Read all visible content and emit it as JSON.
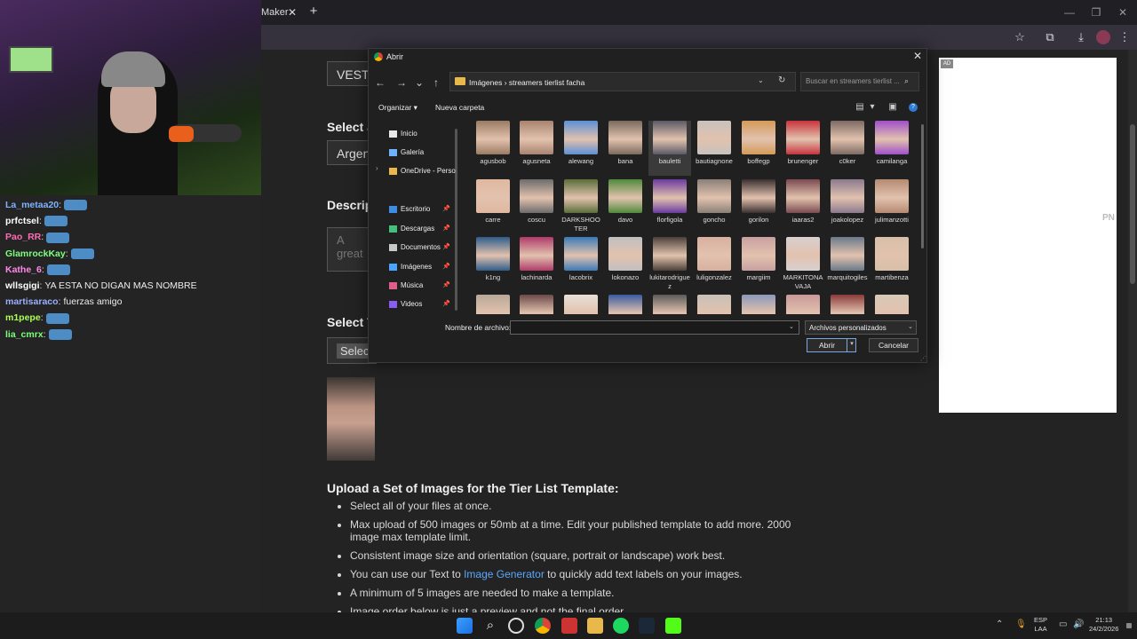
{
  "browser": {
    "tab_title": "Maker",
    "tab_close": "✕",
    "new_tab": "+"
  },
  "page": {
    "field_vesti": "VESTI",
    "label_select_a": "Select a",
    "field_argent": "Argent",
    "label_descrip": "Descrip",
    "field_description_placeholder": "A great",
    "label_select_t": "Select T",
    "field_select": "Selec",
    "upload_title": "Upload a Set of Images for the Tier List Template:",
    "upload_items": [
      "Select all of your files at once.",
      "Max upload of 500 images or 50mb at a time. Edit your published template to add more. 2000 image max template limit.",
      "Consistent image size and orientation (square, portrait or landscape) work best.",
      "A minimum of 5 images are needed to make a template.",
      "Image order below is just a preview and not the final order."
    ],
    "text_gen_before": "You can use our Text to ",
    "text_gen_link": "Image Generator",
    "text_gen_after": " to quickly add text labels on your images.",
    "ad_tag": "AD",
    "ad_text": "PN"
  },
  "chat": [
    {
      "user": "La_metaa20",
      "color": "#7fb2ff",
      "msg": ""
    },
    {
      "user": "prfctsel",
      "color": "#ffffff",
      "msg": ""
    },
    {
      "user": "Pao_RR",
      "color": "#ff6bb5",
      "msg": ""
    },
    {
      "user": "GlamrockKay",
      "color": "#7dff7d",
      "msg": ""
    },
    {
      "user": "Kathe_6",
      "color": "#ff88ee",
      "msg": ""
    },
    {
      "user": "wllsgigi",
      "color": "#ffffff",
      "msg": "YA ESTA NO DIGAN MAS NOMBRE"
    },
    {
      "user": "martisaraco",
      "color": "#9ab0ff",
      "msg": "fuerzas amigo"
    },
    {
      "user": "m1pepe",
      "color": "#aaff55",
      "msg": ""
    },
    {
      "user": "lia_cmrx",
      "color": "#7dff7d",
      "msg": ""
    }
  ],
  "dialog": {
    "title": "Abrir",
    "path": "Imágenes   ›   streamers tierlist facha",
    "search_placeholder": "Buscar en streamers tierlist ...",
    "organize": "Organizar ▾",
    "new_folder": "Nueva carpeta",
    "nav": [
      {
        "label": "Inicio",
        "color": "#e8e8e8",
        "pinned": false
      },
      {
        "label": "Galería",
        "color": "#6fb3ff",
        "pinned": false
      },
      {
        "label": "OneDrive - Perso",
        "color": "#e8b84a",
        "pinned": false
      },
      {
        "label": "Escritorio",
        "color": "#3e8de0",
        "pinned": true
      },
      {
        "label": "Descargas",
        "color": "#44c07a",
        "pinned": true
      },
      {
        "label": "Documentos",
        "color": "#c8c8c8",
        "pinned": true
      },
      {
        "label": "Imágenes",
        "color": "#49a3ff",
        "pinned": true
      },
      {
        "label": "Música",
        "color": "#e05d8b",
        "pinned": true
      },
      {
        "label": "Videos",
        "color": "#8a5cf0",
        "pinned": true
      }
    ],
    "files": [
      {
        "name": "agusbob",
        "color": "#9a7b62"
      },
      {
        "name": "agusneta",
        "color": "#a88470"
      },
      {
        "name": "alewang",
        "color": "#5c8fd6"
      },
      {
        "name": "bana",
        "color": "#7a6a5e"
      },
      {
        "name": "bauletti",
        "color": "#5a5a66",
        "selected": true
      },
      {
        "name": "bautiagnone",
        "color": "#c7c2bd"
      },
      {
        "name": "boffegp",
        "color": "#d49a58"
      },
      {
        "name": "brunenger",
        "color": "#c8343c"
      },
      {
        "name": "c0ker",
        "color": "#7c6a62"
      },
      {
        "name": "camilanga",
        "color": "#a04fc9"
      },
      {
        "name": "carre",
        "color": "#e0b8a0"
      },
      {
        "name": "coscu",
        "color": "#6c6c6c"
      },
      {
        "name": "DARKSHOOTER",
        "color": "#5a6e3a"
      },
      {
        "name": "davo",
        "color": "#4f8a3a"
      },
      {
        "name": "florfigola",
        "color": "#6a3aa0"
      },
      {
        "name": "goncho",
        "color": "#8a8078"
      },
      {
        "name": "gorilon",
        "color": "#3a3030"
      },
      {
        "name": "iaaras2",
        "color": "#7a4a50"
      },
      {
        "name": "joakolopez",
        "color": "#8a7a8e"
      },
      {
        "name": "julimanzotti",
        "color": "#b58a72"
      },
      {
        "name": "k1ng",
        "color": "#2e5c8a"
      },
      {
        "name": "lachinarda",
        "color": "#b03a6a"
      },
      {
        "name": "lacobrix",
        "color": "#3a7ab8"
      },
      {
        "name": "lokonazo",
        "color": "#c0c0c0"
      },
      {
        "name": "lukitarodriguez",
        "color": "#4a4038"
      },
      {
        "name": "luligonzalez",
        "color": "#d8b0a0"
      },
      {
        "name": "margiim",
        "color": "#c8a0a0"
      },
      {
        "name": "MARKITONAVAJA",
        "color": "#d8d0d0"
      },
      {
        "name": "marquitogiles",
        "color": "#6a7a8a"
      },
      {
        "name": "martibenza",
        "color": "#d8c0a8"
      },
      {
        "name": "",
        "color": "#b8a898"
      },
      {
        "name": "",
        "color": "#6a4848"
      },
      {
        "name": "",
        "color": "#e8e0d8"
      },
      {
        "name": "",
        "color": "#3a5aa0"
      },
      {
        "name": "",
        "color": "#5a5a5a"
      },
      {
        "name": "",
        "color": "#c8c0b8"
      },
      {
        "name": "",
        "color": "#8a98b8"
      },
      {
        "name": "",
        "color": "#c89898"
      },
      {
        "name": "",
        "color": "#8a3a3a"
      },
      {
        "name": "",
        "color": "#d8c8b8"
      }
    ],
    "filename_label": "Nombre de archivo:",
    "filename_value": "",
    "filetype": "Archivos personalizados",
    "open_label": "Abrir",
    "cancel_label": "Cancelar"
  },
  "taskbar": {
    "lang": "ESP",
    "lang2": "LAA",
    "time": "21:13",
    "date": "24/2/2026"
  }
}
